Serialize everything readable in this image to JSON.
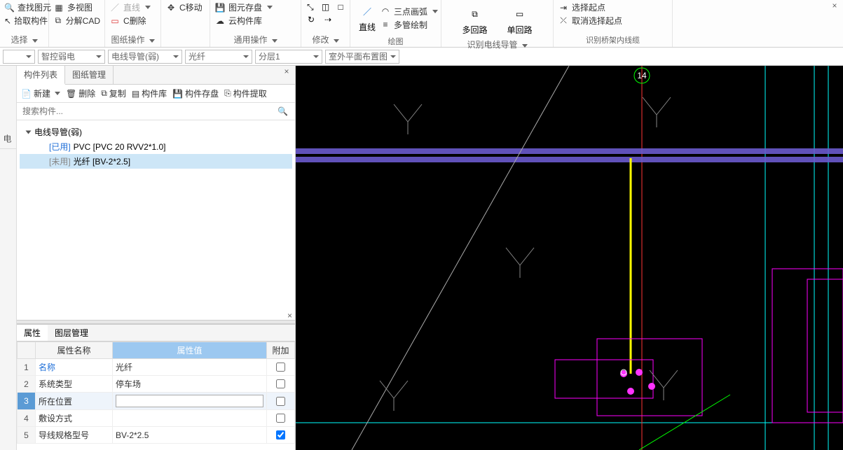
{
  "ribbon": {
    "groups": [
      {
        "label": "选择",
        "items": [
          {
            "id": "find-element",
            "text": "查找图元"
          },
          {
            "id": "pick-component",
            "text": "拾取构件"
          }
        ]
      },
      {
        "label": "",
        "items": [
          {
            "id": "multi-view",
            "text": "多视图"
          },
          {
            "id": "decompose-cad",
            "text": "分解CAD"
          }
        ]
      },
      {
        "label": "图纸操作",
        "items": [
          {
            "id": "line-dim",
            "text": "直线",
            "dim": true
          },
          {
            "id": "c-delete",
            "text": "C删除"
          }
        ]
      },
      {
        "label": "",
        "items": [
          {
            "id": "c-move",
            "text": "C移动"
          }
        ]
      },
      {
        "label": "通用操作",
        "items": [
          {
            "id": "element-save",
            "text": "图元存盘"
          },
          {
            "id": "cloud-component-lib",
            "text": "云构件库"
          }
        ]
      },
      {
        "label": "修改",
        "items": []
      },
      {
        "label": "绘图",
        "big": {
          "id": "line-tool",
          "text": "直线"
        },
        "items": [
          {
            "id": "three-point-arc",
            "text": "三点画弧"
          },
          {
            "id": "multi-pipe-draw",
            "text": "多管绘制"
          }
        ]
      },
      {
        "label": "识别电线导管",
        "items": [
          {
            "id": "multi-loop",
            "text": "多回路"
          },
          {
            "id": "single-loop",
            "text": "单回路"
          }
        ]
      },
      {
        "label": "识别桥架内线缆",
        "items": [
          {
            "id": "select-start",
            "text": "选择起点"
          },
          {
            "id": "cancel-select-start",
            "text": "取消选择起点"
          }
        ]
      }
    ]
  },
  "filters": {
    "f1": "",
    "f2": "智控弱电",
    "f3": "电线导管(弱)",
    "f4": "光纤",
    "f5": "分层1",
    "f6": "室外平面布置图"
  },
  "leftStrip": {
    "tab": "电"
  },
  "componentPanel": {
    "tabs": {
      "list": "构件列表",
      "drawings": "图纸管理"
    },
    "toolbar": {
      "new": "新建",
      "delete": "删除",
      "copy": "复制",
      "lib": "构件库",
      "save": "构件存盘",
      "extract": "构件提取"
    },
    "search_placeholder": "搜索构件...",
    "tree": {
      "root": "电线导管(弱)",
      "items": [
        {
          "tag": "[已用]",
          "tagClass": "used",
          "label": "PVC [PVC 20 RVV2*1.0]"
        },
        {
          "tag": "[未用]",
          "tagClass": "unused",
          "label": "光纤 [BV-2*2.5]",
          "selected": true
        }
      ]
    }
  },
  "propertyPanel": {
    "tabs": {
      "props": "属性",
      "layers": "图层管理"
    },
    "headers": {
      "name": "属性名称",
      "value": "属性值",
      "extra": "附加"
    },
    "rows": [
      {
        "idx": "1",
        "name": "名称",
        "nameLink": true,
        "value": "光纤",
        "check": false
      },
      {
        "idx": "2",
        "name": "系统类型",
        "value": "停车场",
        "check": false
      },
      {
        "idx": "3",
        "name": "所在位置",
        "value": "",
        "editing": true,
        "selected": true,
        "check": false
      },
      {
        "idx": "4",
        "name": "敷设方式",
        "value": "",
        "check": false
      },
      {
        "idx": "5",
        "name": "导线规格型号",
        "value": "BV-2*2.5",
        "check": true
      }
    ]
  },
  "canvas": {
    "marker": "14"
  }
}
